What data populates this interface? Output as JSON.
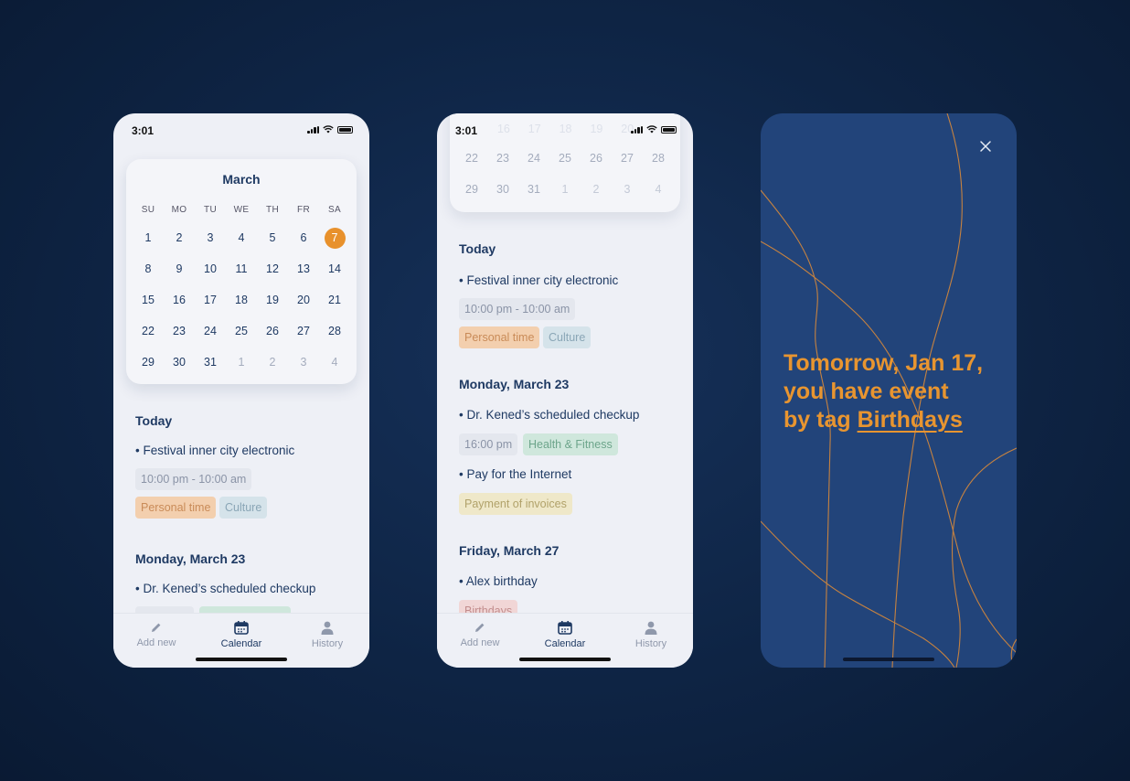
{
  "status": {
    "time": "3:01"
  },
  "calendar": {
    "month": "March",
    "weekdays": [
      "SU",
      "MO",
      "TU",
      "WE",
      "TH",
      "FR",
      "SA"
    ],
    "weeks": [
      [
        "1",
        "2",
        "3",
        "4",
        "5",
        "6",
        "7"
      ],
      [
        "8",
        "9",
        "10",
        "11",
        "12",
        "13",
        "14"
      ],
      [
        "15",
        "16",
        "17",
        "18",
        "19",
        "20",
        "21"
      ],
      [
        "22",
        "23",
        "24",
        "25",
        "26",
        "27",
        "28"
      ],
      [
        "29",
        "30",
        "31",
        "1",
        "2",
        "3",
        "4"
      ]
    ],
    "selected_day": "7",
    "accent_color": "#e8912c"
  },
  "agenda": {
    "today": {
      "heading": "Today",
      "event": "• Festival inner city electronic",
      "time": "10:00 pm - 10:00 am",
      "tags": [
        "Personal time",
        "Culture"
      ]
    },
    "monday": {
      "heading": "Monday, March 23",
      "event1": "• Dr. Kened’s scheduled checkup",
      "event1_time": "16:00 pm",
      "event1_tag": "Health & Fitness",
      "event2": "• Pay for the Internet",
      "event2_tag": "Payment of invoices"
    },
    "friday": {
      "heading": "Friday, March 27",
      "event": "• Alex birthday",
      "tag": "Birthdays"
    }
  },
  "ghost_calendar": {
    "faint_row": [
      "16",
      "17",
      "18",
      "19",
      "20"
    ],
    "rows": [
      [
        "22",
        "23",
        "24",
        "25",
        "26",
        "27",
        "28"
      ],
      [
        "29",
        "30",
        "31",
        "1",
        "2",
        "3",
        "4"
      ]
    ]
  },
  "tabbar": {
    "add_new": "Add new",
    "calendar": "Calendar",
    "history": "History"
  },
  "notification": {
    "line1": "Tomorrow, Jan 17,",
    "line2": "you have event",
    "line3_prefix": "by tag ",
    "line3_link": "Birthdays",
    "text_color": "#e89530",
    "background": "#22447a"
  }
}
